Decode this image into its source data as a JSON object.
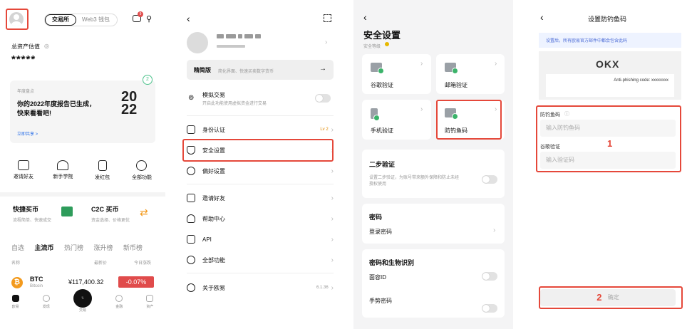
{
  "screen1": {
    "tabs": [
      "交易所",
      "Web3 钱包"
    ],
    "msg_badge": "9",
    "total_label": "总资产估值",
    "total_value": "*****",
    "report": {
      "tag": "年度盘点",
      "title_line1": "你的2022年度报告已生成，",
      "title_line2": "快来看看吧!",
      "link": "立即共享 >",
      "year_top": "20",
      "year_bottom": "22",
      "count": "2"
    },
    "quick_actions": [
      "邀请好友",
      "新手学院",
      "发红包",
      "全部功能"
    ],
    "promo": [
      {
        "title": "快捷买币",
        "sub": "流程简单、快速成交"
      },
      {
        "title": "C2C 买币",
        "sub": "资金选择、价格更优"
      }
    ],
    "market_tabs": [
      "自选",
      "主流币",
      "热门榜",
      "涨升榜",
      "新币榜"
    ],
    "table_headers": [
      "名称",
      "最新价",
      "今日涨跌"
    ],
    "row": {
      "symbol": "BTC",
      "name": "Bitcoin",
      "price": "¥117,400.32",
      "change": "-0.07%"
    },
    "nav": [
      "欧易",
      "发现",
      "交易",
      "金融",
      "资产"
    ]
  },
  "screen2": {
    "lite_title": "精简版",
    "lite_sub": "简化界面、快速买卖数字货币",
    "demo_title": "模拟交易",
    "demo_sub": "开启此功能使用虚拟资金进行交易",
    "kyc_label": "身份认证",
    "kyc_level": "Lv 2",
    "security_label": "安全设置",
    "pref_label": "偏好设置",
    "invite_label": "邀请好友",
    "help_label": "帮助中心",
    "api_label": "API",
    "all_label": "全部功能",
    "about_label": "关于欧易",
    "version": "6.1.36"
  },
  "screen3": {
    "title": "安全设置",
    "level": "安全等级",
    "tiles": [
      "谷歌验证",
      "邮箱验证",
      "手机验证",
      "防钓鱼码"
    ],
    "twofa_title": "二步验证",
    "twofa_desc_line1": "设置二步验证，为账号带来额外保障和防止未经",
    "twofa_desc_line2": "授权使用",
    "pwd_title": "密码",
    "login_pwd": "登录密码",
    "bio_title": "密码和生物识别",
    "face_id": "面容ID",
    "gesture": "手势密码"
  },
  "screen4": {
    "title": "设置防钓鱼码",
    "notice": "设置后，所有欧易官方邮件中都会包含此码",
    "logo": "OKX",
    "anti_text": "Anti-phishing code: xxxxxxxx",
    "code_label": "防钓鱼码",
    "code_placeholder": "输入防钓鱼码",
    "google_label": "谷歌验证",
    "google_placeholder": "输入验证码",
    "step1": "1",
    "step2": "2",
    "confirm": "确定"
  }
}
